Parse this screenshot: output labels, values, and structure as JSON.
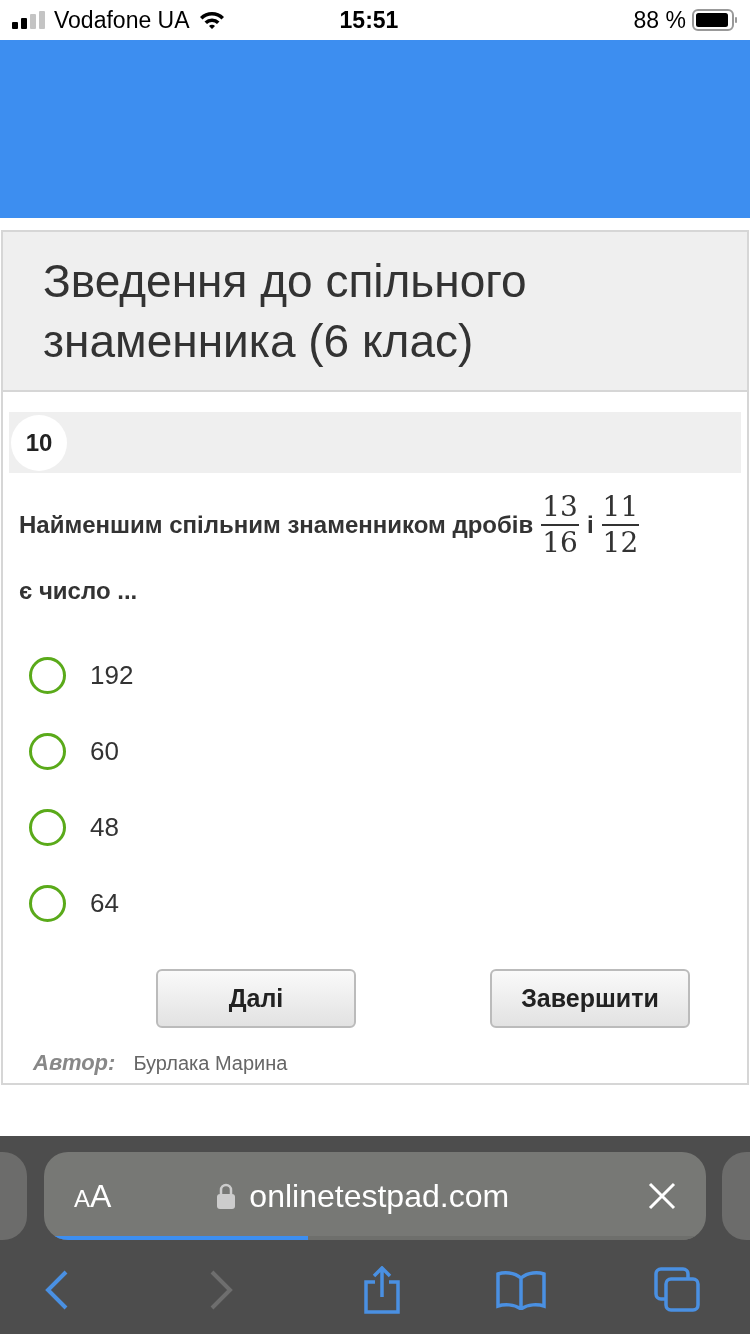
{
  "status_bar": {
    "carrier": "Vodafone UA",
    "time": "15:51",
    "battery": "88 %"
  },
  "test": {
    "title": "Зведення до спільного знаменника (6 клас)"
  },
  "question": {
    "number": "10",
    "parts": [
      {
        "kind": "text",
        "text": "Найменшим спільним знаменником дробів"
      },
      {
        "kind": "fraction",
        "numerator": "13",
        "denominator": "16"
      },
      {
        "kind": "text",
        "text": "і"
      },
      {
        "kind": "fraction",
        "numerator": "11",
        "denominator": "12"
      },
      {
        "kind": "line",
        "text": "є число ..."
      }
    ]
  },
  "options": [
    {
      "label": "192",
      "selected": false
    },
    {
      "label": "60",
      "selected": false
    },
    {
      "label": "48",
      "selected": false
    },
    {
      "label": "64",
      "selected": false
    }
  ],
  "buttons": [
    "Далі",
    "Завершити"
  ],
  "author": {
    "label": "Автор:",
    "name": "Бурлака Марина"
  },
  "browser": {
    "text_size": "AA",
    "url": "onlinetestpad.com",
    "level": 0.39,
    "back_disabled": false,
    "forward_disabled": true
  }
}
